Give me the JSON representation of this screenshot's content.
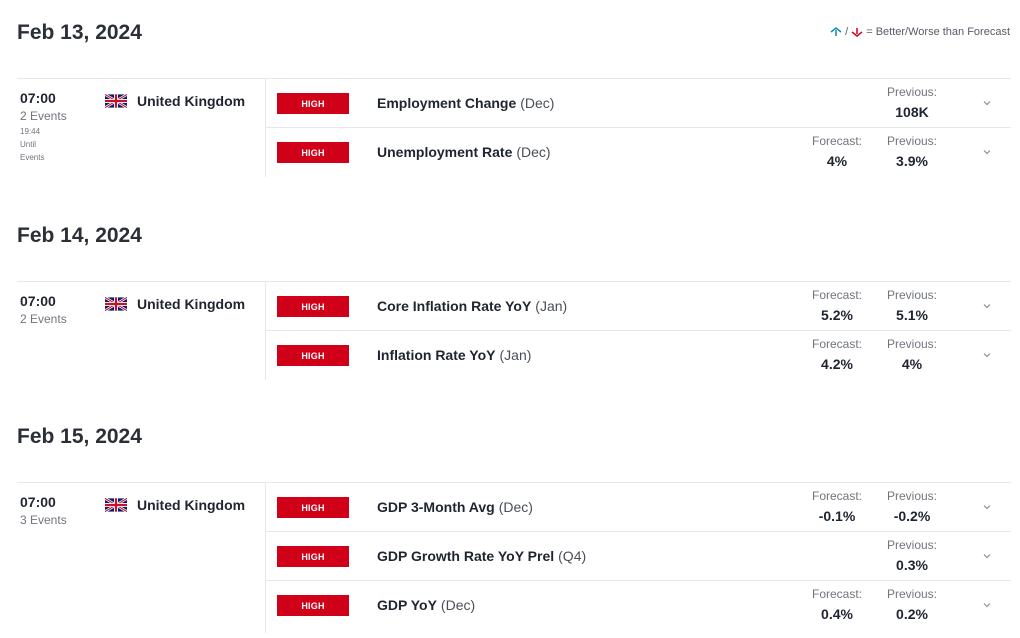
{
  "legend": {
    "text": "= Better/Worse than Forecast",
    "better_color": "#1b8fb5",
    "worse_color": "#c8102e"
  },
  "priority_color": "#d00018",
  "days": [
    {
      "date": "Feb 13, 2024",
      "groups": [
        {
          "time": "07:00",
          "events_count": "2 Events",
          "until_time": "19:44",
          "until_label": "Until",
          "until_suffix": "Events",
          "country": "United Kingdom",
          "flag": "uk-flag-icon",
          "events": [
            {
              "priority": "HIGH",
              "name": "Employment Change",
              "period": "(Dec)",
              "forecast_label": "",
              "forecast": "",
              "previous_label": "Previous:",
              "previous": "108K"
            },
            {
              "priority": "HIGH",
              "name": "Unemployment Rate",
              "period": "(Dec)",
              "forecast_label": "Forecast:",
              "forecast": "4%",
              "previous_label": "Previous:",
              "previous": "3.9%"
            }
          ]
        }
      ]
    },
    {
      "date": "Feb 14, 2024",
      "groups": [
        {
          "time": "07:00",
          "events_count": "2 Events",
          "country": "United Kingdom",
          "flag": "uk-flag-icon",
          "events": [
            {
              "priority": "HIGH",
              "name": "Core Inflation Rate YoY",
              "period": "(Jan)",
              "forecast_label": "Forecast:",
              "forecast": "5.2%",
              "previous_label": "Previous:",
              "previous": "5.1%"
            },
            {
              "priority": "HIGH",
              "name": "Inflation Rate YoY",
              "period": "(Jan)",
              "forecast_label": "Forecast:",
              "forecast": "4.2%",
              "previous_label": "Previous:",
              "previous": "4%"
            }
          ]
        }
      ]
    },
    {
      "date": "Feb 15, 2024",
      "groups": [
        {
          "time": "07:00",
          "events_count": "3 Events",
          "country": "United Kingdom",
          "flag": "uk-flag-icon",
          "events": [
            {
              "priority": "HIGH",
              "name": "GDP 3-Month Avg",
              "period": "(Dec)",
              "forecast_label": "Forecast:",
              "forecast": "-0.1%",
              "previous_label": "Previous:",
              "previous": "-0.2%"
            },
            {
              "priority": "HIGH",
              "name": "GDP Growth Rate YoY Prel",
              "period": "(Q4)",
              "forecast_label": "",
              "forecast": "",
              "previous_label": "Previous:",
              "previous": "0.3%"
            },
            {
              "priority": "HIGH",
              "name": "GDP YoY",
              "period": "(Dec)",
              "forecast_label": "Forecast:",
              "forecast": "0.4%",
              "previous_label": "Previous:",
              "previous": "0.2%"
            }
          ]
        }
      ]
    }
  ]
}
